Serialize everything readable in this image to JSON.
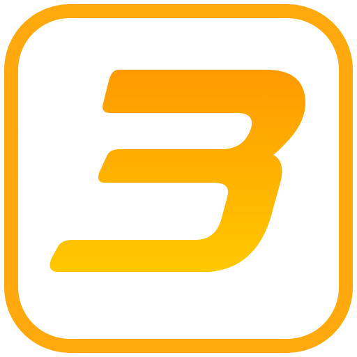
{
  "app_icon": {
    "name": "3-logo-icon",
    "glyph": "3",
    "colors": {
      "frame": "#ffa90f",
      "glyph_top": "#ff9a00",
      "glyph_bottom": "#ffc800",
      "background": "#ffffff"
    }
  }
}
